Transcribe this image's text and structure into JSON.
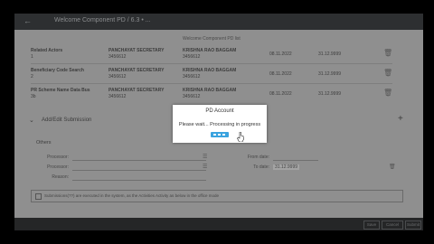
{
  "window": {
    "title": "Welcome Component PD / 6.3 • ...",
    "back_icon": "back-arrow-icon"
  },
  "sub_header": "Welcome Component PD list",
  "rows": [
    {
      "name": "Related Actors",
      "num": "1",
      "designation": "PANCHAYAT SECRETARY",
      "code1": "3456612",
      "person": "KRISHNA RAO BAGGAM",
      "code2": "3456612",
      "date": "08.11.2022",
      "amount": "31.12.9999"
    },
    {
      "name": "Beneficiary Code Search",
      "num": "2",
      "designation": "PANCHAYAT SECRETARY",
      "code1": "3456612",
      "person": "KRISHNA RAO BAGGAM",
      "code2": "3456612",
      "date": "08.11.2022",
      "amount": "31.12.9999"
    },
    {
      "name": "PR Scheme Name Data Bus",
      "num": "3b",
      "designation": "PANCHAYAT SECRETARY",
      "code1": "3456612",
      "person": "KRISHNA RAO BAGGAM",
      "code2": "3456612",
      "date": "08.11.2022",
      "amount": "31.12.9999"
    }
  ],
  "section": {
    "label": "Add/Edit Submission",
    "plus": "+"
  },
  "others": {
    "heading": "Others",
    "fields": [
      {
        "label": "Processor:",
        "value": ""
      },
      {
        "label": "Processor:",
        "value": ""
      },
      {
        "label": "Reason:",
        "value": ""
      }
    ],
    "right_fields": [
      {
        "label": "From date:",
        "value": ""
      },
      {
        "label": "To date:",
        "value": "31.12.9999"
      }
    ]
  },
  "notice_text": "Submissions(??) are executed in the system, as the Activities Activity as below in the office mode",
  "footer": {
    "buttons": [
      "Save",
      "Cancel",
      "Submit"
    ]
  },
  "dialog": {
    "title": "PD Account",
    "message": "Please wait... Processing in progress"
  },
  "colors": {
    "dialog_accent": "#3aa3df",
    "overlay": "#8f8f8f"
  }
}
